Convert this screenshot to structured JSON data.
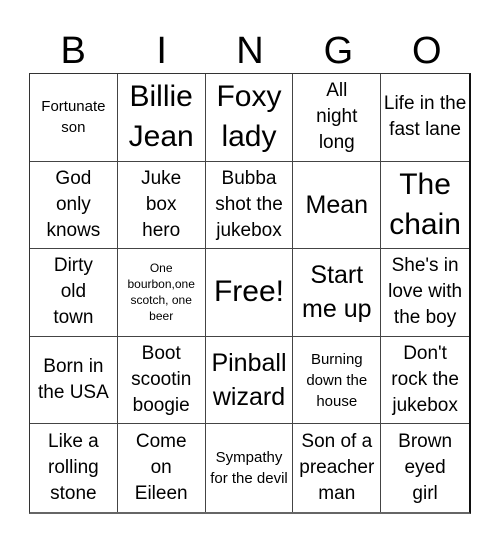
{
  "header": {
    "letters": [
      "B",
      "I",
      "N",
      "G",
      "O"
    ]
  },
  "card": {
    "cells": [
      "Fortunate son",
      "Billie Jean",
      "Foxy lady",
      "All night long",
      "Life in the fast lane",
      "God only knows",
      "Juke box hero",
      "Bubba shot the jukebox",
      "Mean",
      "The chain",
      "Dirty old town",
      "One bourbon,one scotch, one beer",
      "Free!",
      "Start me up",
      "She's in love with the boy",
      "Born in the USA",
      "Boot scootin boogie",
      "Pinball wizard",
      "Burning down the house",
      "Don't rock the jukebox",
      "Like a rolling stone",
      "Come on Eileen",
      "Sympathy for the devil",
      "Son of a preacher man",
      "Brown eyed girl"
    ]
  }
}
